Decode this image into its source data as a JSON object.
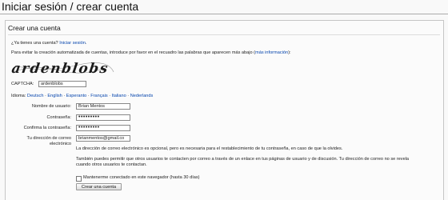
{
  "page": {
    "title": "Iniciar sesión / crear cuenta"
  },
  "form": {
    "legend": "Crear una cuenta",
    "have_account_prefix": "¿Ya tienes una cuenta?",
    "login_link": "Iniciar sesión",
    "have_account_suffix": ".",
    "captcha_intro": "Para evitar la creación automatizada de cuentas, introduce por favor en el recuadro las palabras que aparecen más abajo (",
    "more_info_link": "más información",
    "captcha_intro_end": "):",
    "captcha_image_text": "ardenblobs",
    "captcha_label": "CAPTCHA:",
    "captcha_value": "ardenblobs",
    "language_label": "Idioma:",
    "languages": [
      "Deutsch",
      "English",
      "Esperanto",
      "Français",
      "Italiano",
      "Nederlands"
    ],
    "username_label": "Nombre de usuario:",
    "username_value": "Brian Mentos",
    "password_label": "Contraseña:",
    "password_value": "•••••••••",
    "confirm_label": "Confirma la contraseña:",
    "confirm_value": "•••••••••",
    "email_label_1": "Tu dirección de correo",
    "email_label_2": "electrónico",
    "email_value": "brianmentos@gmail.co",
    "email_help_1": "La dirección de correo electrónico es opcional, pero es necesaria para el restablecimiento de tu contraseña, en caso de que la olvides.",
    "email_help_2": "También puedes permitir que otros usuarios te contacten por correo a través de un enlace en tus páginas de usuario y de discusión. Tu dirección de correo no se revela",
    "email_help_3": "cuando otros usuarios te contactan.",
    "remember_label": "Mantenerme conectado en este navegador (hasta 30 días)",
    "submit_label": "Crear una cuenta"
  }
}
